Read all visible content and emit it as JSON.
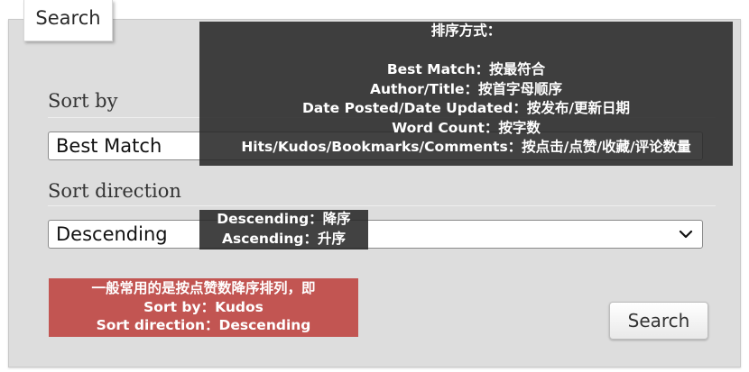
{
  "tab": {
    "label": "Search"
  },
  "sort_by": {
    "label": "Sort by",
    "selected": "Best Match"
  },
  "sort_direction": {
    "label": "Sort direction",
    "selected": "Descending"
  },
  "annotation_sort_by": {
    "title": "排序方式：",
    "lines": [
      "Best Match：按最符合",
      "Author/Title：按首字母顺序",
      "Date Posted/Date Updated：按发布/更新日期",
      "Word Count：按字数",
      "Hits/Kudos/Bookmarks/Comments：按点击/点赞/收藏/评论数量"
    ]
  },
  "annotation_direction": {
    "lines": [
      "Descending：降序",
      "Ascending：升序"
    ]
  },
  "annotation_tip": {
    "lines": [
      "一般常用的是按点赞数降序排列，即",
      "Sort by：Kudos",
      "Sort direction：Descending"
    ]
  },
  "submit": {
    "label": "Search"
  },
  "icons": {
    "dropdown": "chevron-down-icon"
  },
  "colors": {
    "tooltip_dark": "#282828",
    "tooltip_red": "#c25552",
    "panel": "#dddddd"
  }
}
